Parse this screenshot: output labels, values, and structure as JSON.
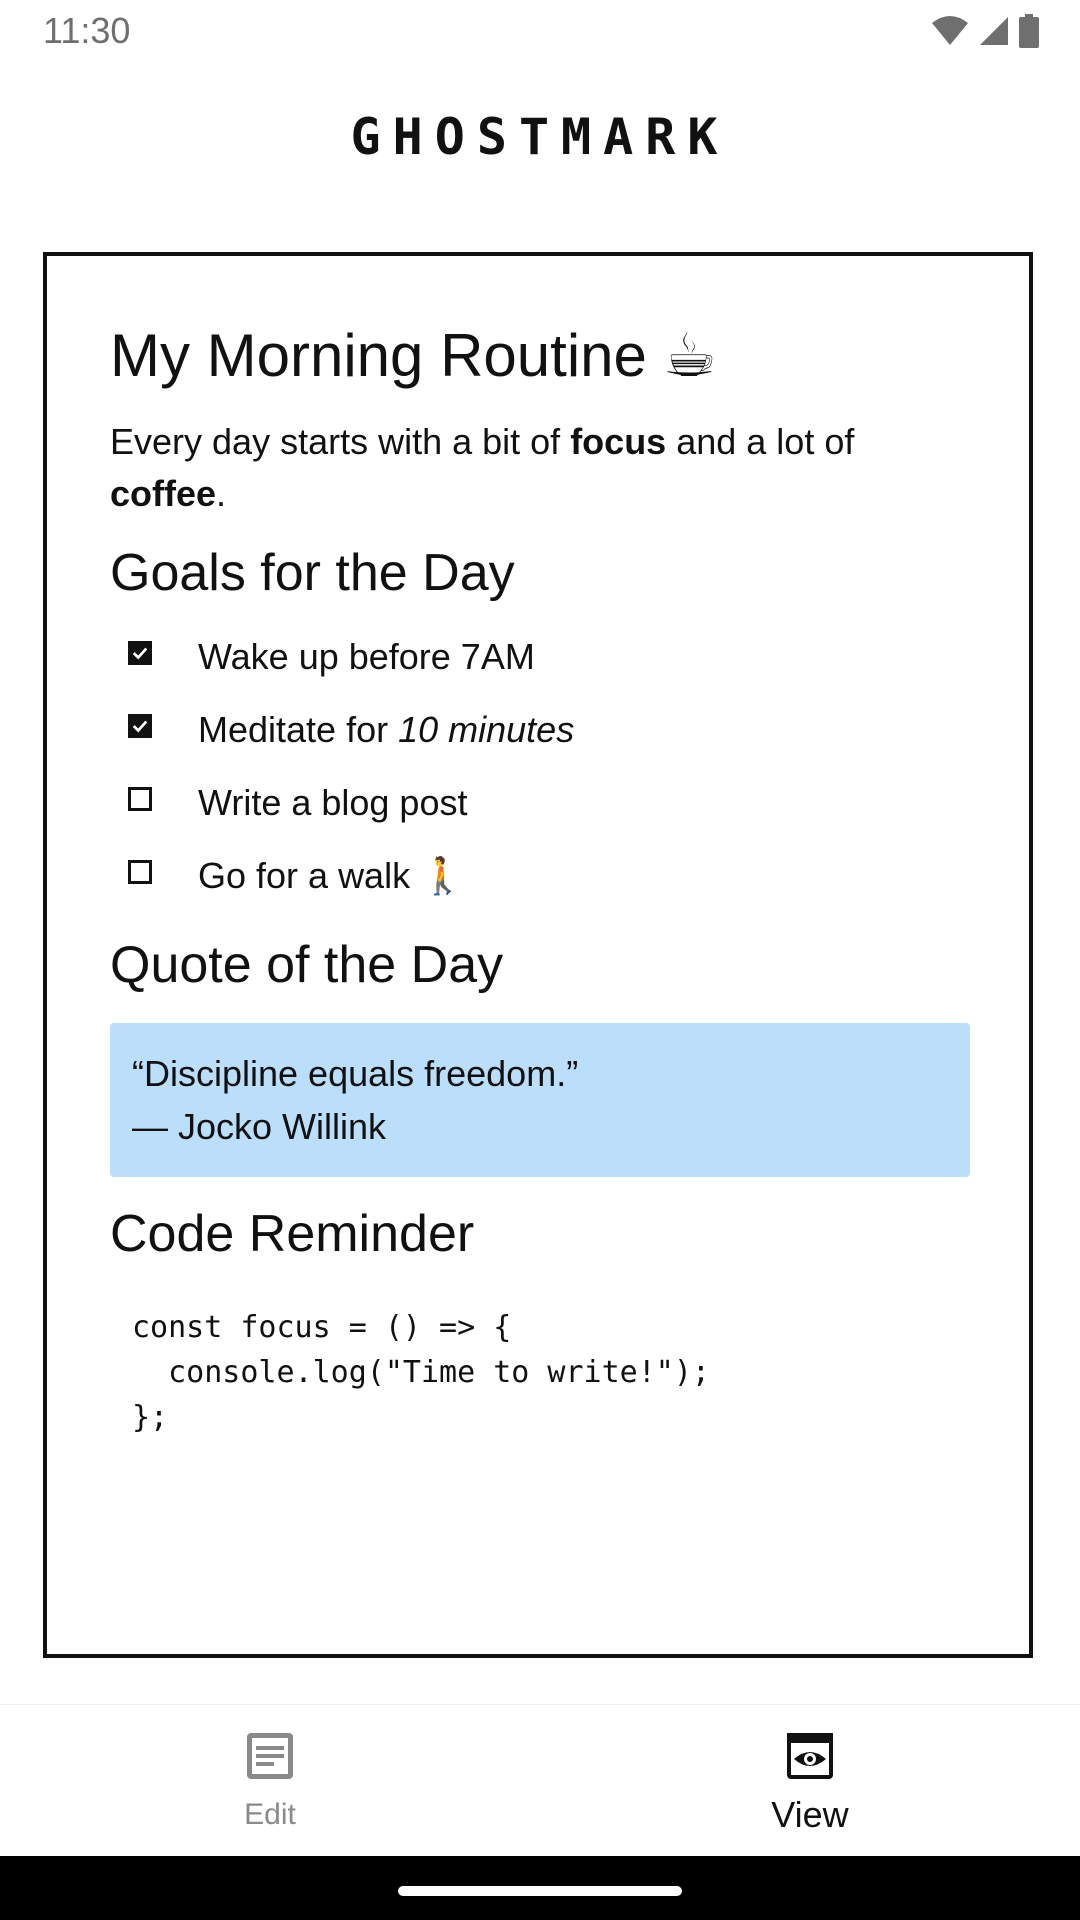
{
  "status": {
    "time": "11:30",
    "icons": [
      "wifi-icon",
      "cellular-signal-icon",
      "battery-icon"
    ]
  },
  "app": {
    "title": "GHOSTMARK"
  },
  "document": {
    "title": "My Morning Routine",
    "title_emoji": "☕",
    "intro": {
      "part1": "Every day starts with a bit of ",
      "bold1": "focus",
      "part2": " and a lot of ",
      "bold2": "coffee",
      "part3": "."
    },
    "goals_heading": "Goals for the Day",
    "tasks": [
      {
        "text": "Wake up before 7AM",
        "checked": true
      },
      {
        "text": "Meditate for ",
        "italic": "10 minutes",
        "checked": true
      },
      {
        "text": "Write a blog post",
        "checked": false
      },
      {
        "text": "Go for a walk",
        "emoji": "🚶",
        "checked": false
      }
    ],
    "quote_heading": "Quote of the Day",
    "quote": {
      "text": "“Discipline equals freedom.”",
      "author": "— Jocko Willink"
    },
    "code_heading": "Code Reminder",
    "code": "const focus = () => {\n  console.log(\"Time to write!\");\n};"
  },
  "bottom_nav": {
    "edit_label": "Edit",
    "view_label": "View",
    "active": "View"
  },
  "colors": {
    "quote_background": "#bbdefb",
    "inactive_nav": "#8a8a8a",
    "frame": "#111111"
  }
}
